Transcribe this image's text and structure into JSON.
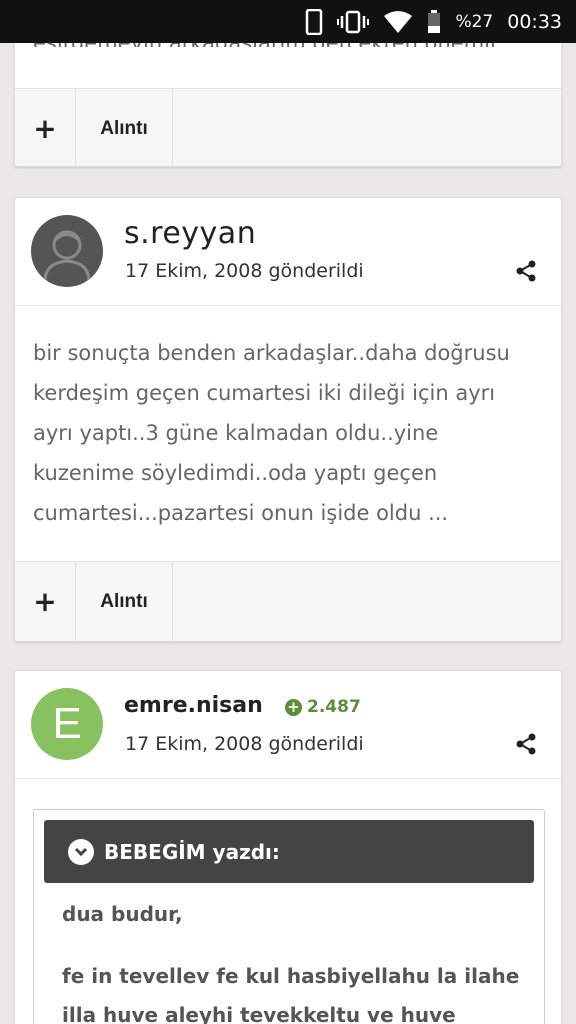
{
  "status_bar": {
    "battery_percent": "%27",
    "time": "00:33"
  },
  "partial_post": {
    "text_fragment": "esirgemeyin arkadaşlarım gerçekten önemli",
    "plus_label": "+",
    "quote_label": "Alıntı"
  },
  "post1": {
    "username": "s.reyyan",
    "date": "17 Ekim, 2008 gönderildi",
    "lines": [
      "bir sonuçta benden arkadaşlar..daha doğrusu",
      "kerdeşim geçen cumartesi iki dileği için ayrı",
      "ayrı yaptı..3 güne kalmadan oldu..yine",
      "kuzenime söyledimdi..oda yaptı geçen",
      "cumartesi...pazartesi onun işide oldu ..."
    ],
    "plus_label": "+",
    "quote_label": "Alıntı"
  },
  "post2": {
    "avatar_letter": "E",
    "username": "emre.nisan",
    "reputation": "2.487",
    "date": "17 Ekim, 2008 gönderildi",
    "quote": {
      "author_line": "BEBEGİM yazdı:",
      "line1": "dua budur,",
      "line2": "fe in tevellev fe kul hasbiyellahu la ilahe",
      "line3": "illa huve aleyhi tevekkeltu ve huve"
    }
  },
  "colors": {
    "background": "#ebe7e6",
    "reputation_green": "#5a8f3a",
    "avatar_green": "#88c260",
    "quote_header": "#444444"
  }
}
